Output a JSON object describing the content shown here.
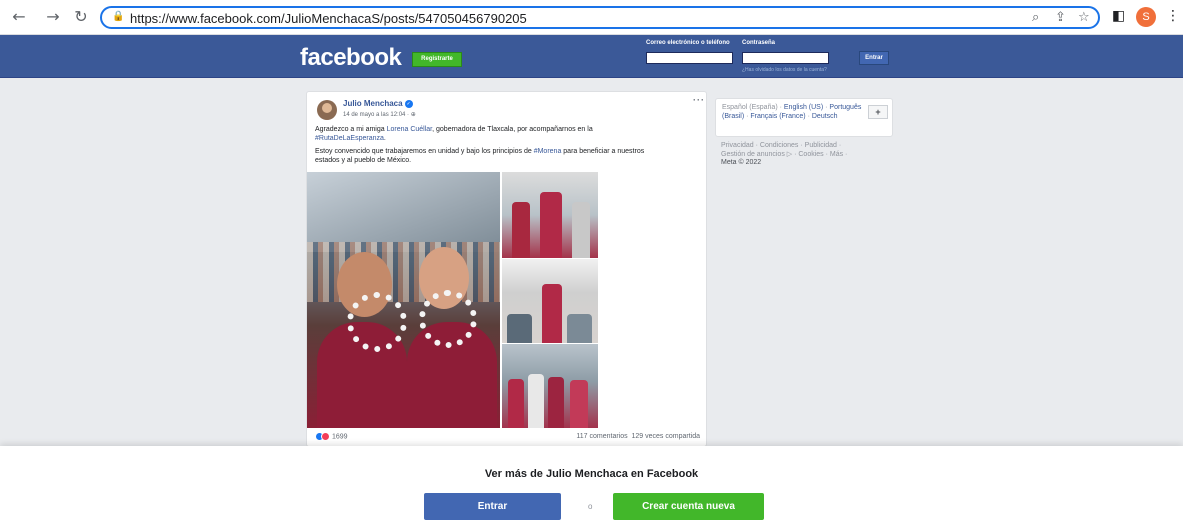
{
  "browser": {
    "url": "https://www.facebook.com/JulioMenchacaS/posts/547050456790205",
    "profile_initial": "S"
  },
  "header": {
    "logo": "facebook",
    "register_label": "Registrarte",
    "email_label": "Correo electrónico o teléfono",
    "password_label": "Contraseña",
    "forgot_label": "¿Has olvidado los datos de la cuenta?",
    "login_label": "Entrar"
  },
  "post": {
    "author": "Julio Menchaca",
    "date": "14 de mayo a las 12:04 · ",
    "more": "···",
    "line1_pre": "Agradezco a mi amiga ",
    "line1_link": "Lorena Cuéllar",
    "line1_post": ", gobernadora de Tlaxcala, por acompañarnos en la",
    "line2_tag": "#RutaDeLaEsperanza",
    "line2_post": ".",
    "line3_pre": "Estoy convencido que trabajaremos en unidad y bajo los principios de ",
    "line3_tag": "#Morena",
    "line3_post": " para beneficiar a nuestros",
    "line4": "estados y al pueblo de México.",
    "reaction_count": "1699",
    "comments": "117 comentarios",
    "shares": "129 veces compartida"
  },
  "languages": {
    "current": "Español (España)",
    "sep": " · ",
    "options": [
      "English (US)",
      "Português (Brasil)",
      "Français (France)",
      "Deutsch"
    ],
    "plus": "+"
  },
  "footer": {
    "line1": "Privacidad · Condiciones · Publicidad ·",
    "line2": "Gestión de anuncios ▷ · Cookies · Más ·",
    "copyright": "Meta © 2022"
  },
  "overlay": {
    "title": "Ver más de Julio Menchaca en Facebook",
    "enter_label": "Entrar",
    "or_label": "o",
    "create_label": "Crear cuenta nueva"
  },
  "colors": {
    "facebook_blue": "#3b5998",
    "green": "#42b72a",
    "link": "#385898"
  }
}
